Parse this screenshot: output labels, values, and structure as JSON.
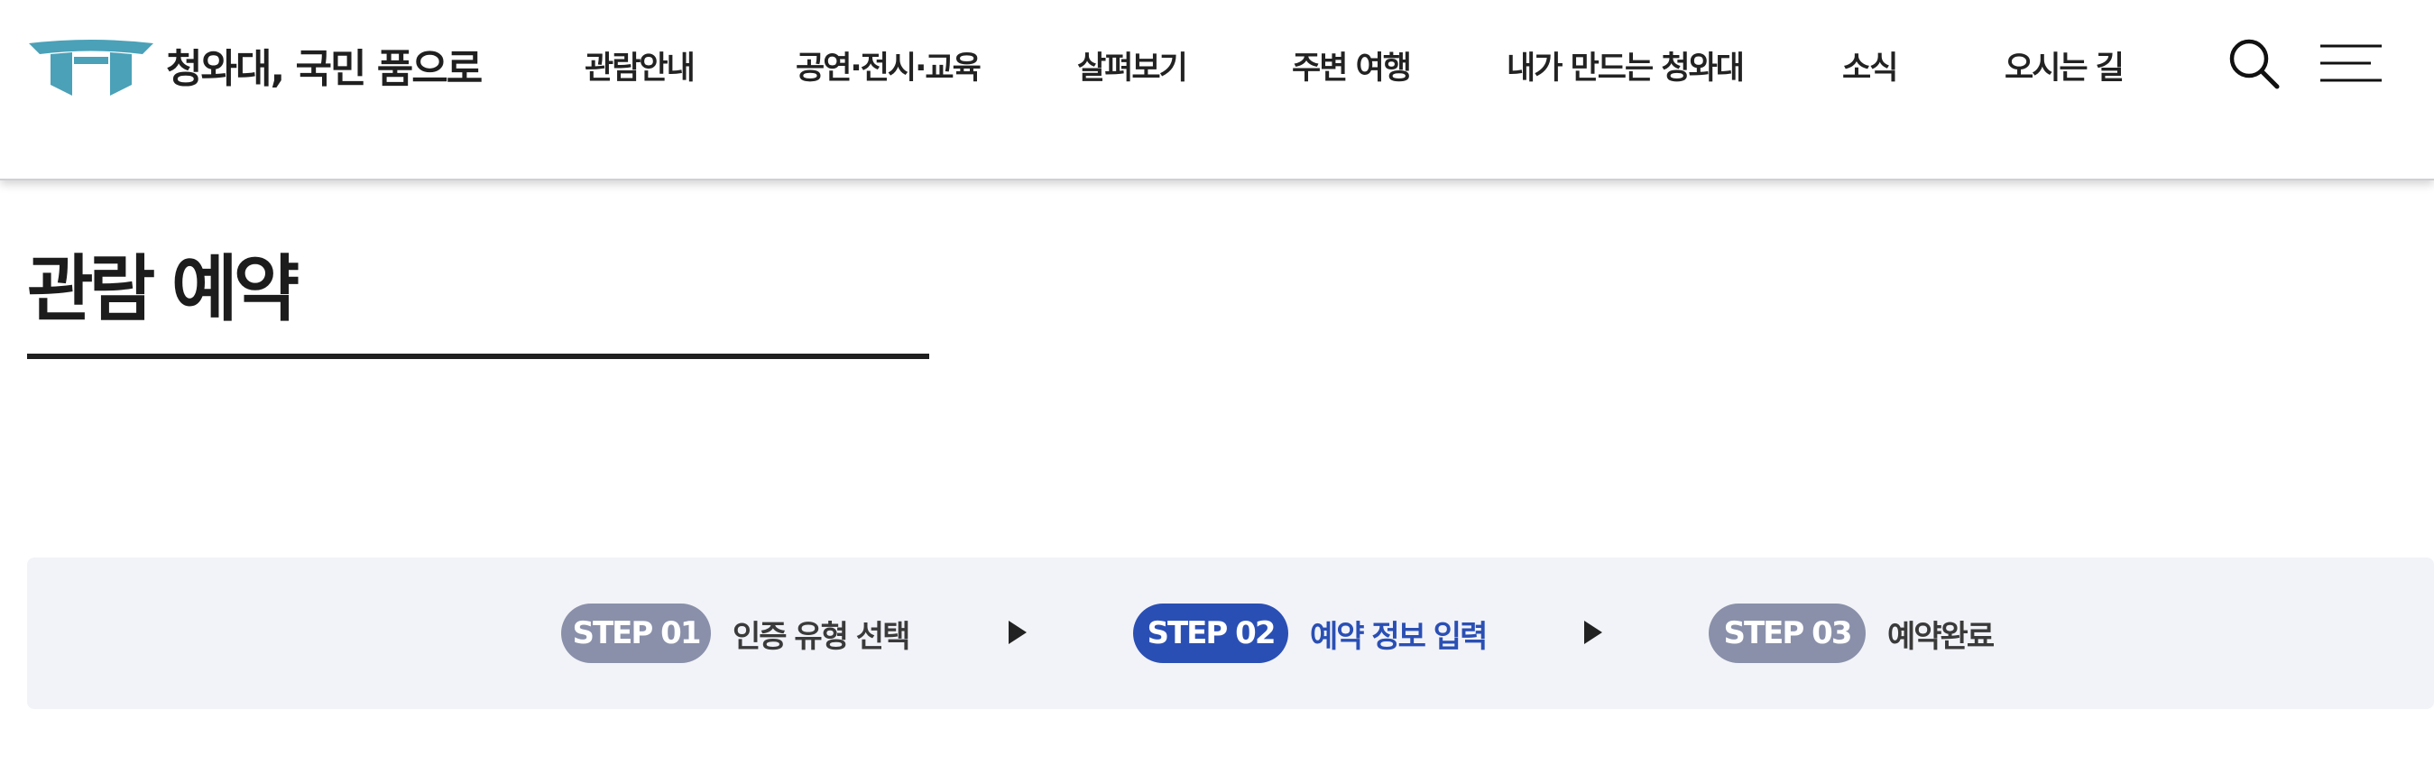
{
  "header": {
    "site_name": "청와대, 국민 품으로",
    "logo_icon": "gate-logo-icon",
    "logo_color": "#4aa1b8",
    "nav": [
      {
        "label": "관람안내"
      },
      {
        "label": "공연·전시·교육"
      },
      {
        "label": "살펴보기"
      },
      {
        "label": "주변 여행"
      },
      {
        "label": "내가 만드는 청와대"
      },
      {
        "label": "소식"
      },
      {
        "label": "오시는 길"
      }
    ],
    "search_icon": "search-icon",
    "menu_icon": "hamburger-menu-icon"
  },
  "main": {
    "page_title": "관람 예약"
  },
  "steps": {
    "active_color": "#2a4fb4",
    "inactive_color": "#8a90aa",
    "items": [
      {
        "badge": "STEP 01",
        "label": "인증 유형 선택",
        "state": "inactive"
      },
      {
        "badge": "STEP 02",
        "label": "예약 정보 입력",
        "state": "active"
      },
      {
        "badge": "STEP 03",
        "label": "예약완료",
        "state": "inactive"
      }
    ],
    "separator_icon": "play-arrow-icon"
  }
}
